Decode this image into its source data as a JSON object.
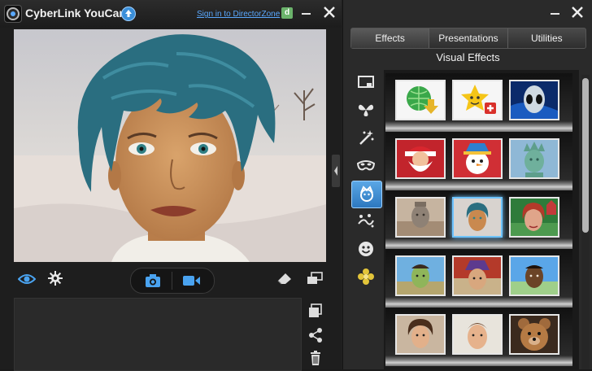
{
  "window": {
    "title": "CyberLink YouCam",
    "signin_link": "Sign in to DirectorZone",
    "directorzone_badge": "d"
  },
  "right_panel": {
    "tabs": [
      {
        "label": "Effects",
        "active": true
      },
      {
        "label": "Presentations",
        "active": false
      },
      {
        "label": "Utilities",
        "active": false
      }
    ],
    "section_title": "Visual Effects",
    "categories": [
      "frame-icon",
      "butterfly-icon",
      "magic-wand-icon",
      "mask-icon",
      "avatar-icon",
      "particles-icon",
      "smiley-icon",
      "flower-icon"
    ],
    "selected_category": "avatar-icon"
  },
  "effects": [
    [
      "download-effect",
      "favorite-effect",
      "alien-avatar"
    ],
    [
      "santa-avatar",
      "snowman-avatar",
      "statue-of-liberty-avatar"
    ],
    [
      "terracotta-warrior-avatar",
      "blue-hair-avatar",
      "red-hair-avatar"
    ],
    [
      "green-face-avatar",
      "purple-hat-avatar",
      "dark-avatar"
    ],
    [
      "brown-hair-avatar",
      "man-avatar",
      "teddy-bear-avatar"
    ]
  ],
  "selected_effect": "blue-hair-avatar",
  "colors": {
    "accent": "#3b8fd9",
    "link": "#5aa9ff",
    "selection": "#6ec3ff",
    "panel": "#2a2a2a"
  }
}
